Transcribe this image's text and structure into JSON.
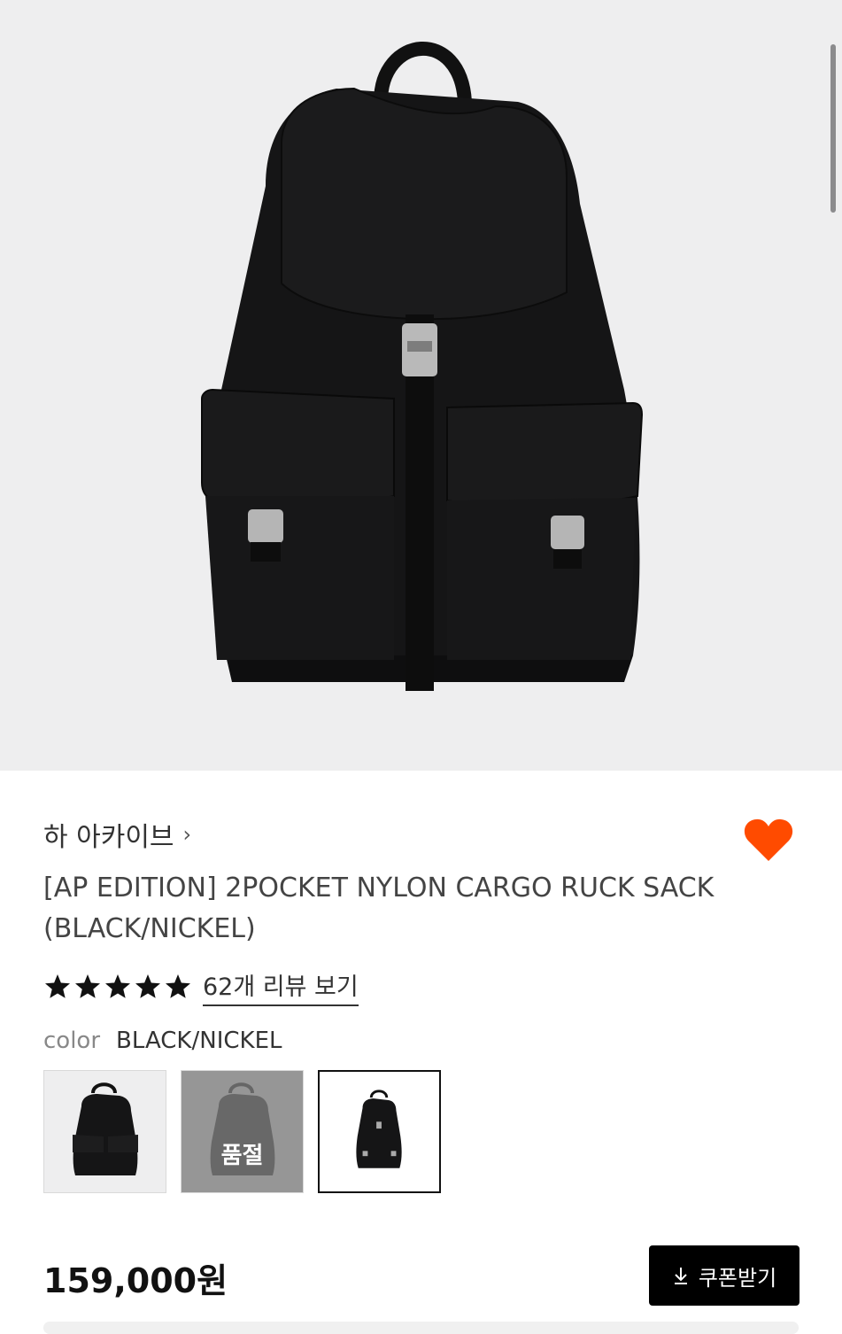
{
  "brand": {
    "name": "하 아카이브",
    "chevron": "›"
  },
  "product": {
    "title": "[AP EDITION] 2POCKET NYLON CARGO RUCK SACK (BLACK/NICKEL)",
    "rating": 5,
    "review_link": "62개 리뷰 보기",
    "color_label": "color",
    "color_value": "BLACK/NICKEL",
    "thumbnails": [
      {
        "name": "black",
        "sold_out": false,
        "selected": false
      },
      {
        "name": "gray",
        "sold_out": true,
        "selected": false,
        "badge": "품절"
      },
      {
        "name": "black-nickel",
        "sold_out": false,
        "selected": true
      }
    ],
    "price": "159,000원",
    "coupon_button": "쿠폰받기",
    "favorite": true
  },
  "colors": {
    "accent": "#ff4b00",
    "button_bg": "#000000",
    "hero_bg": "#eeeeef"
  },
  "icons": {
    "favorite": "heart-icon",
    "download": "download-icon",
    "star": "star-icon"
  }
}
